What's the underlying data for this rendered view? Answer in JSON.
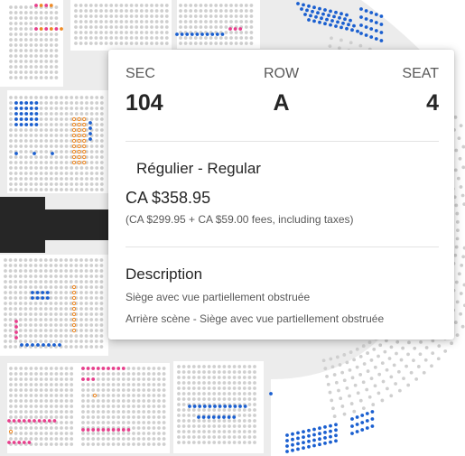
{
  "colors": {
    "available": "#1a5fd0",
    "resale": "#e83e8c",
    "accessible": "#ef8a25",
    "unavailable": "#cfcfcf",
    "stage": "#262626"
  },
  "seat_popup": {
    "sec_label": "SEC",
    "row_label": "ROW",
    "seat_label": "SEAT",
    "sec_value": "104",
    "row_value": "A",
    "seat_value": "4",
    "ticket_type": "Régulier - Regular",
    "price": "CA $358.95",
    "price_breakdown": "(CA $299.95 + CA $59.00 fees, including taxes)",
    "description_title": "Description",
    "description_lines": [
      "Siège avec vue partiellement obstruée",
      "Arrière scène - Siège avec vue partiellement obstruée"
    ]
  }
}
